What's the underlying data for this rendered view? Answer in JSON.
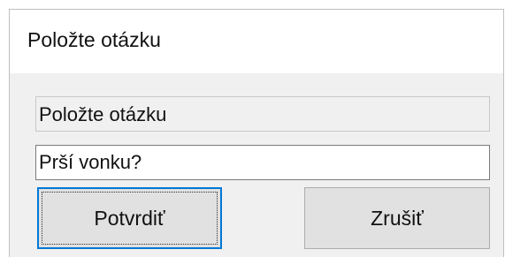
{
  "window": {
    "title": "Položte otázku"
  },
  "prompt": {
    "label": "Položte otázku"
  },
  "input": {
    "value": "Prší vonku?"
  },
  "buttons": {
    "confirm_label": "Potvrdiť",
    "cancel_label": "Zrušiť"
  },
  "colors": {
    "dialog_background": "#f0f0f0",
    "title_background": "#ffffff",
    "focus_accent": "#0078d7",
    "button_face": "#e1e1e1"
  }
}
